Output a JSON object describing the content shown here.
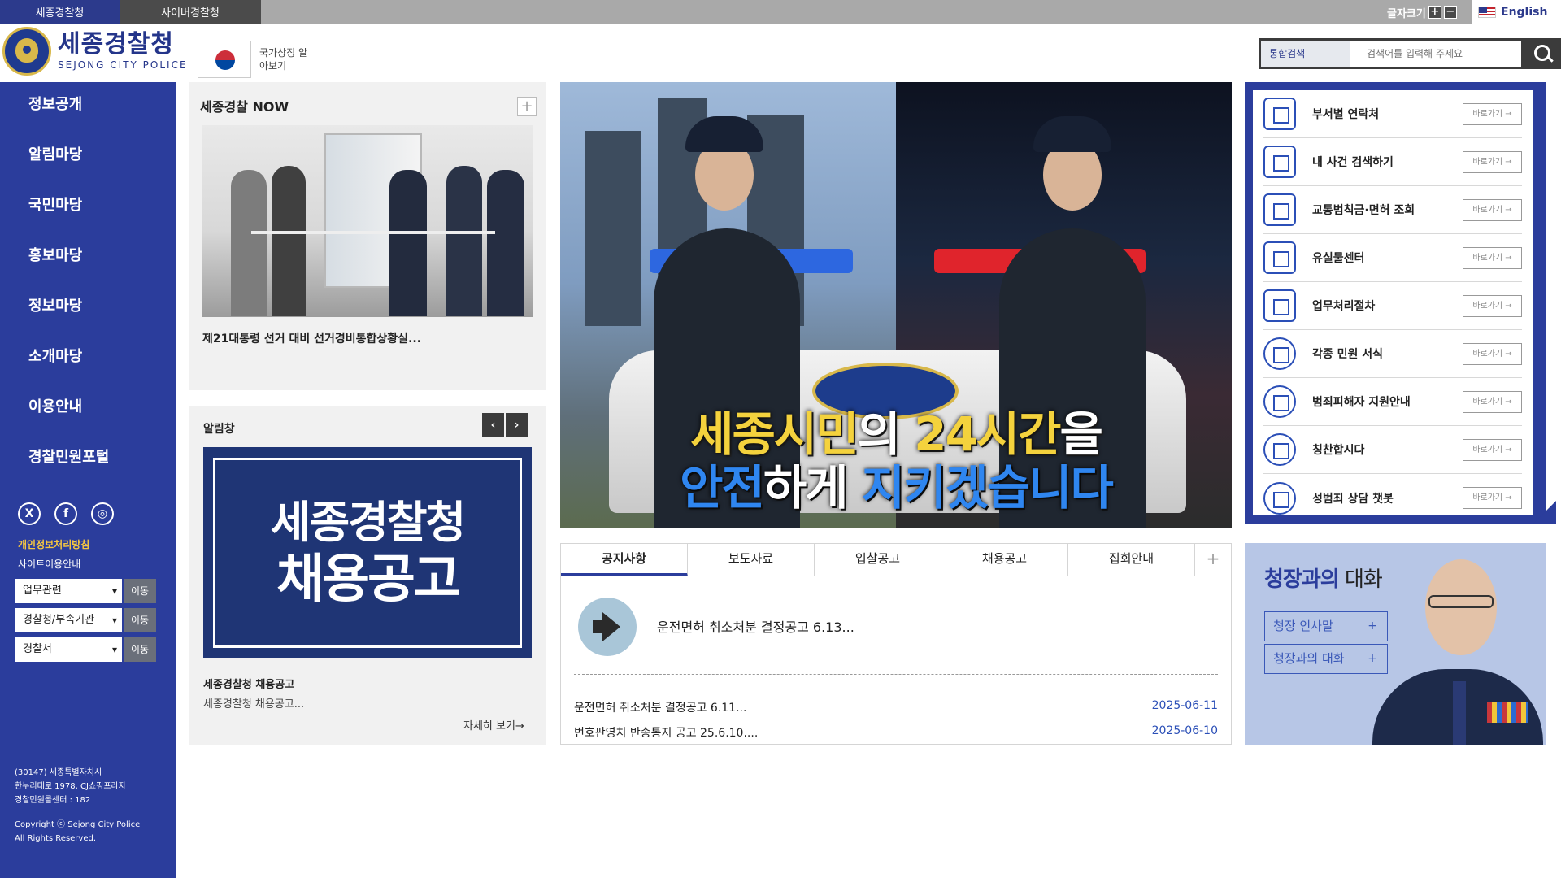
{
  "topbar": {
    "tab_sejong": "세종경찰청",
    "tab_cyber": "사이버경찰청",
    "font_size_label": "글자크기",
    "font_plus": "+",
    "font_minus": "−",
    "language": "English"
  },
  "header": {
    "logo_ko": "세종경찰청",
    "logo_en": "SEJONG CITY POLICE",
    "national_symbol_label": "국가상징 알아보기",
    "search_scope": "통합검색",
    "search_placeholder": "검색어를 입력해 주세요"
  },
  "leftnav": {
    "items": [
      "정보공개",
      "알림마당",
      "국민마당",
      "홍보마당",
      "정보마당",
      "소개마당",
      "이용안내",
      "경찰민원포털"
    ],
    "sns": [
      "X",
      "f",
      "◎"
    ],
    "privacy": "개인정보처리방침",
    "terms": "사이트이용안내",
    "selects": [
      {
        "value": "업무관련",
        "go": "이동"
      },
      {
        "value": "경찰청/부속기관",
        "go": "이동"
      },
      {
        "value": "경찰서",
        "go": "이동"
      }
    ],
    "address_lines": [
      "(30147) 세종특별자치시",
      "한누리대로 1978, CJ쇼핑프라자",
      "경찰민원콜센터 : 182"
    ],
    "copyright_lines": [
      "Copyright ⓒ Sejong City Police",
      "All Rights Reserved."
    ]
  },
  "now": {
    "title": "세종경찰 NOW",
    "plus": "+",
    "caption": "제21대통령 선거 대비 선거경비통합상황실..."
  },
  "alarm": {
    "title": "알림창",
    "prev": "‹",
    "next": "›",
    "banner_line1": "세종경찰청",
    "banner_line2": "채용공고",
    "caption_title": "세종경찰청 채용공고",
    "caption_body": "세종경찰청 채용공고...",
    "more": "자세히 보기→"
  },
  "hero": {
    "line1_a": "세종시민",
    "line1_b": "의 ",
    "line1_c": "24시간",
    "line1_d": "을",
    "line2_a": "안전",
    "line2_b": "하게 ",
    "line2_c": "지키겠습니다"
  },
  "notice": {
    "tabs": [
      "공지사항",
      "보도자료",
      "입찰공고",
      "채용공고",
      "집회안내"
    ],
    "plus": "+",
    "feature": "운전면허 취소처분 결정공고 6.13...",
    "rows": [
      {
        "title": "운전면허 취소처분 결정공고 6.11...",
        "date": "2025-06-11"
      },
      {
        "title": "번호판영치 반송통지 공고 25.6.10....",
        "date": "2025-06-10"
      }
    ]
  },
  "quick": {
    "button_label": "바로가기 →",
    "items": [
      {
        "label": "부서별 연락처",
        "icon": "phonebook-icon"
      },
      {
        "label": "내 사건 검색하기",
        "icon": "computer-search-icon"
      },
      {
        "label": "교통범칙금·면허 조회",
        "icon": "document-magnifier-icon"
      },
      {
        "label": "유실물센터",
        "icon": "locker-icon"
      },
      {
        "label": "업무처리절차",
        "icon": "checklist-icon"
      },
      {
        "label": "각종 민원 서식",
        "icon": "cloud-download-icon"
      },
      {
        "label": "범죄피해자 지원안내",
        "icon": "heart-icon"
      },
      {
        "label": "칭찬합시다",
        "icon": "hand-heart-icon"
      },
      {
        "label": "성범죄 상담 챗봇",
        "icon": "chatbot-icon"
      }
    ]
  },
  "chief": {
    "title_a": "청장과의",
    "title_b": " 대화",
    "btn_greeting": "청장 인사말",
    "btn_talk": "청장과의 대화",
    "plus": "+"
  },
  "colors": {
    "brand_blue": "#2b3d9c",
    "top_gray": "#a9a9a9",
    "date_blue": "#2b4fb7",
    "accent_yellow": "#f4c542"
  }
}
